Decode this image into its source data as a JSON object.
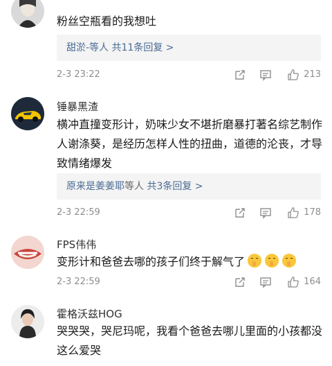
{
  "comments": [
    {
      "text": "粉丝空瓶看的我想吐",
      "replies": {
        "names": "甜淤-等人",
        "count_text": "共11条回复 >"
      },
      "time": "2-3 23:22",
      "likes": "213"
    },
    {
      "username": "锤暴黑渣",
      "text": "横冲直撞变形计，奶味少女不堪折磨暴打著名综艺制作人谢涤葵，是经历怎样人性的扭曲，道德的沦丧，才导致情绪爆发",
      "replies": {
        "names": "原来是姜姜耶",
        "suffix": "等人",
        "count_text": "共3条回复 >"
      },
      "time": "2-3 22:59",
      "likes": "178"
    },
    {
      "username": "FPS伟伟",
      "text": "变形计和爸爸去哪的孩子们终于解气了",
      "emoji": [
        "shush-face-emoji",
        "shush-face-emoji",
        "shush-face-emoji"
      ],
      "time": "2-3 22:59",
      "likes": "164"
    },
    {
      "username": "霍格沃兹HOG",
      "text": "哭哭哭，哭尼玛呢，我看个爸爸去哪儿里面的小孩都没这么爱哭"
    }
  ],
  "icons": {
    "share": "share-icon",
    "reply": "comment-icon",
    "like": "thumbs-up-icon"
  },
  "colors": {
    "link": "#4a6b95",
    "meta": "#8d8d8d",
    "reply_bg": "#f4f4f4"
  }
}
